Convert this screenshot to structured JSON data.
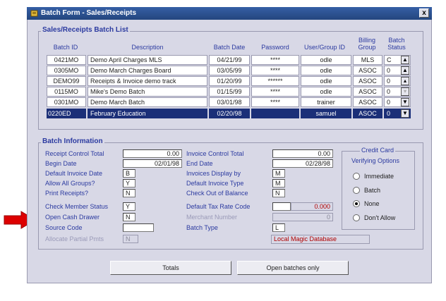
{
  "window": {
    "title": "Batch Form - Sales/Receipts",
    "close_label": "x"
  },
  "batch_list": {
    "title": "Sales/Receipts Batch List",
    "columns": {
      "batch_id": "Batch ID",
      "description": "Description",
      "batch_date": "Batch Date",
      "password": "Password",
      "user_group_id": "User/Group ID",
      "billing_group": "Billing Group",
      "batch_status": "Batch Status"
    },
    "rows": [
      {
        "batch_id": "0421MO",
        "description": "Demo April Charges MLS",
        "batch_date": "04/21/99",
        "password": "****",
        "user": "odle",
        "billing": "MLS",
        "status": "C"
      },
      {
        "batch_id": "0305MO",
        "description": "Demo March Charges Board",
        "batch_date": "03/05/99",
        "password": "****",
        "user": "odle",
        "billing": "ASOC",
        "status": "0"
      },
      {
        "batch_id": "DEMO99",
        "description": "Receipts & Invoice demo track",
        "batch_date": "01/20/99",
        "password": "******",
        "user": "odle",
        "billing": "ASOC",
        "status": "0"
      },
      {
        "batch_id": "0115MO",
        "description": "Mike's Demo Batch",
        "batch_date": "01/15/99",
        "password": "****",
        "user": "odle",
        "billing": "ASOC",
        "status": "0"
      },
      {
        "batch_id": "0301MO",
        "description": "Demo March Batch",
        "batch_date": "03/01/98",
        "password": "****",
        "user": "trainer",
        "billing": "ASOC",
        "status": "0"
      },
      {
        "batch_id": "0220ED",
        "description": "February Education",
        "batch_date": "02/20/98",
        "password": "",
        "user": "samuel",
        "billing": "ASOC",
        "status": "0"
      }
    ],
    "nav_icons": [
      "scroll-first-icon",
      "scroll-page-up-icon",
      "scroll-up-icon",
      "scroll-down-icon",
      "scroll-page-down-icon",
      "scroll-last-icon"
    ]
  },
  "batch_info": {
    "title": "Batch Information",
    "left": {
      "receipt_control_total": {
        "label": "Receipt Control Total",
        "value": "0.00"
      },
      "begin_date": {
        "label": "Begin Date",
        "value": "02/01/98"
      },
      "default_invoice_date": {
        "label": "Default Invoice Date",
        "value": "B"
      },
      "allow_all_groups": {
        "label": "Allow All Groups?",
        "value": "Y"
      },
      "print_receipts": {
        "label": "Print Receipts?",
        "value": "N"
      },
      "check_member_status": {
        "label": "Check Member Status",
        "value": "Y"
      },
      "open_cash_drawer": {
        "label": "Open Cash Drawer",
        "value": "N"
      },
      "source_code": {
        "label": "Source Code",
        "value": ""
      },
      "allocate_partial_pmts": {
        "label": "Allocate Partial Pmts",
        "value": "N"
      }
    },
    "right": {
      "invoice_control_total": {
        "label": "Invoice Control Total",
        "value": "0.00"
      },
      "end_date": {
        "label": "End Date",
        "value": "02/28/98"
      },
      "invoices_display_by": {
        "label": "Invoices Display by",
        "value": "M"
      },
      "default_invoice_type": {
        "label": "Default Invoice Type",
        "value": "M"
      },
      "check_out_of_balance": {
        "label": "Check Out of Balance",
        "value": "N"
      },
      "default_tax_rate_code": {
        "label": "Default Tax Rate Code",
        "value": "",
        "amount": "0.000"
      },
      "merchant_number": {
        "label": "Merchant Number",
        "value": "0"
      },
      "batch_type": {
        "label": "Batch Type",
        "value": "L",
        "description": "Local Magic Database"
      }
    },
    "credit_card": {
      "title": "Credit Card",
      "subtitle": "Verifying Options",
      "options": [
        "Immediate",
        "Batch",
        "None",
        "Don't Allow"
      ],
      "selected": "None"
    }
  },
  "buttons": {
    "totals": "Totals",
    "open_batches_only": "Open batches only"
  },
  "colors": {
    "title_bar": "#2d5296",
    "selected_row": "#1b2f78",
    "label_blue": "#2b3aa0",
    "arrow_red": "#dd0000"
  }
}
